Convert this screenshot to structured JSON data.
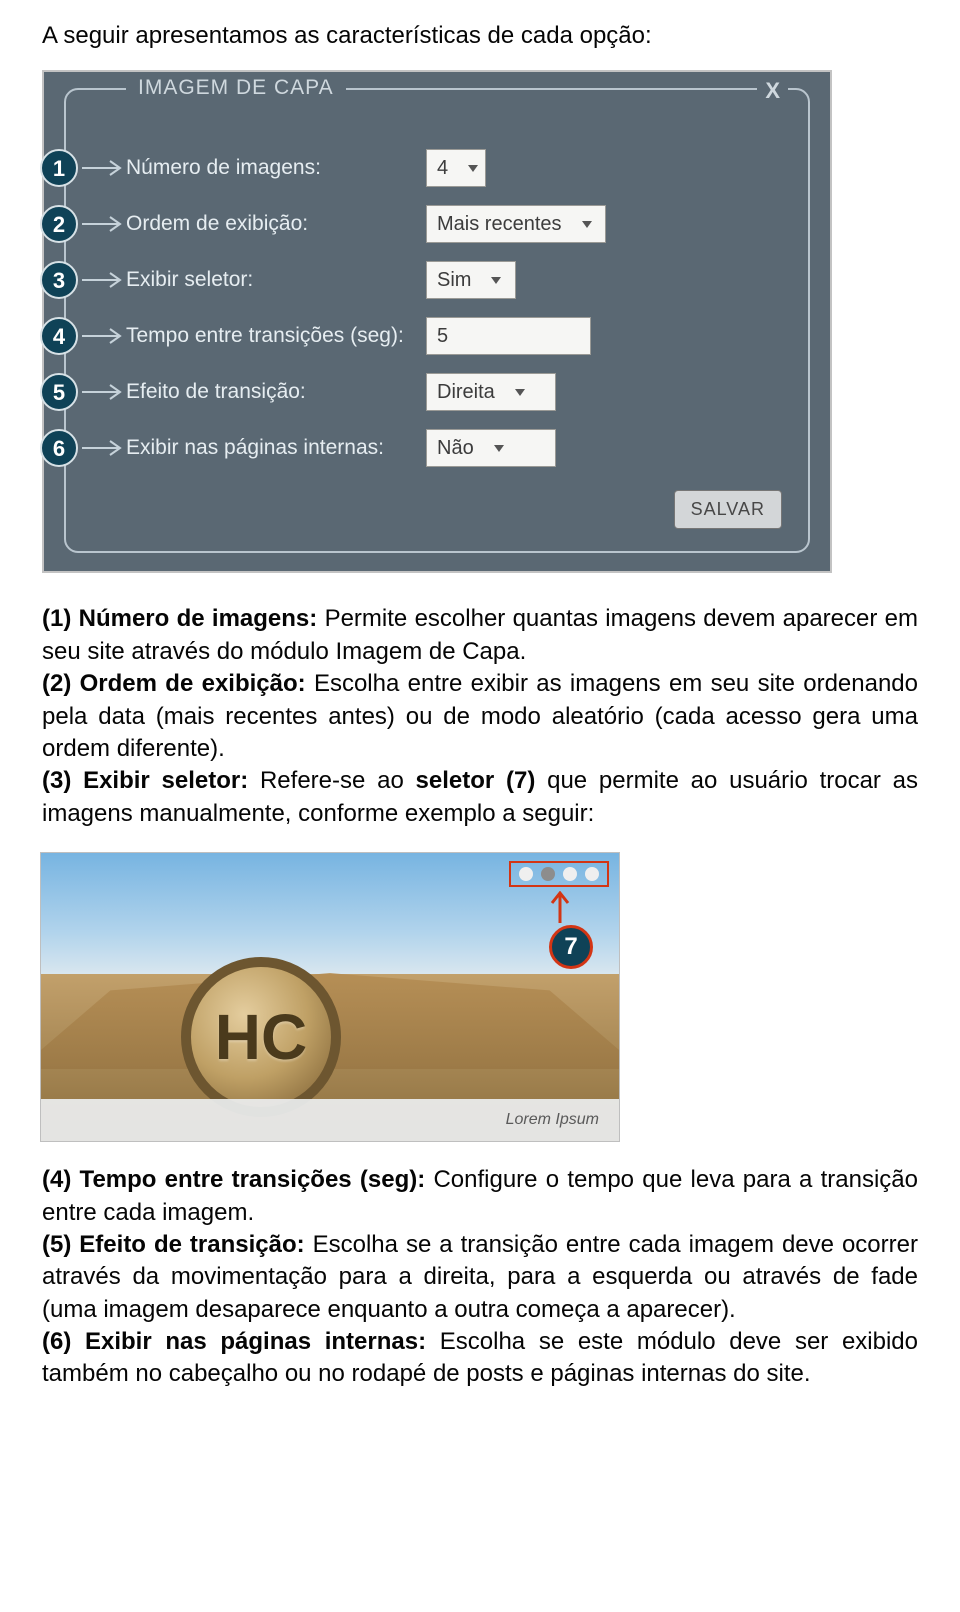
{
  "intro": "A seguir apresentamos as características de cada opção:",
  "panel": {
    "legend": "IMAGEM DE CAPA",
    "close": "X",
    "save": "SALVAR",
    "rows": [
      {
        "num": "1",
        "label": "Número de imagens:",
        "value": "4",
        "type": "select"
      },
      {
        "num": "2",
        "label": "Ordem de exibição:",
        "value": "Mais recentes",
        "type": "select"
      },
      {
        "num": "3",
        "label": "Exibir seletor:",
        "value": "Sim",
        "type": "select"
      },
      {
        "num": "4",
        "label": "Tempo entre transições (seg):",
        "value": "5",
        "type": "input"
      },
      {
        "num": "5",
        "label": "Efeito de transição:",
        "value": "Direita",
        "type": "select"
      },
      {
        "num": "6",
        "label": "Exibir nas páginas internas:",
        "value": "Não",
        "type": "select"
      }
    ]
  },
  "desc": {
    "p1_b": "(1) Número de imagens: ",
    "p1": "Permite escolher quantas imagens devem aparecer em seu site através do módulo Imagem de Capa.",
    "p2_b": "(2) Ordem de exibição: ",
    "p2": "Escolha entre exibir as imagens em seu site ordenando pela data (mais recentes antes) ou de modo aleatório (cada acesso gera uma ordem diferente).",
    "p3_b": "(3) Exibir seletor: ",
    "p3_mid1": "Refere-se ao ",
    "p3_b2": "seletor (7)",
    "p3_mid2": " que permite ao usuário trocar as imagens manualmente, conforme exemplo a seguir:"
  },
  "example": {
    "caption": "Lorem Ipsum",
    "callout": "7",
    "crest": "HC"
  },
  "desc2": {
    "p4_b": "(4) Tempo entre transições (seg): ",
    "p4": "Configure o tempo que leva para a transição entre cada imagem.",
    "p5_b": "(5) Efeito de transição: ",
    "p5": "Escolha se a transição entre cada imagem deve ocorrer através da movimentação para a direita, para a esquerda ou através de fade (uma imagem desaparece enquanto a outra começa a aparecer).",
    "p6_b": "(6) Exibir nas páginas internas: ",
    "p6": "Escolha se este módulo deve ser exibido também no cabeçalho ou no rodapé de posts e páginas internas do site."
  }
}
